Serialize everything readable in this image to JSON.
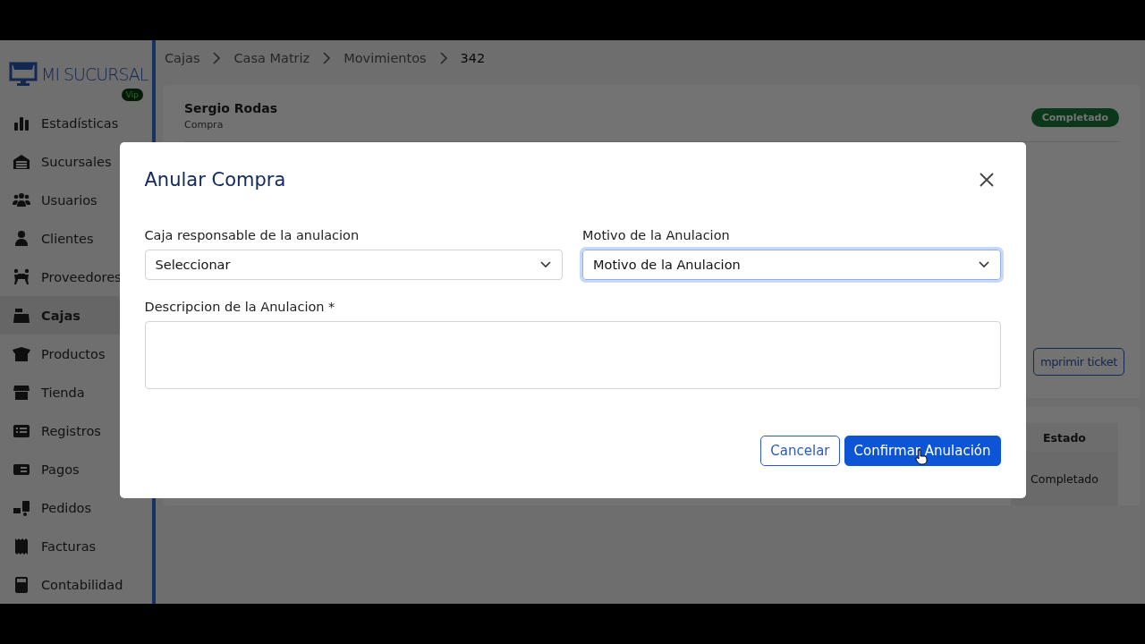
{
  "sidebar": {
    "logo": "MI SUCURSAL",
    "plan_badge": "Vip",
    "items": [
      {
        "label": "Estadísticas",
        "selected": false
      },
      {
        "label": "Sucursales",
        "selected": false
      },
      {
        "label": "Usuarios",
        "selected": false
      },
      {
        "label": "Clientes",
        "selected": false
      },
      {
        "label": "Proveedores",
        "selected": false
      },
      {
        "label": "Cajas",
        "selected": true
      },
      {
        "label": "Productos",
        "selected": false
      },
      {
        "label": "Tienda",
        "selected": false
      },
      {
        "label": "Registros",
        "selected": false
      },
      {
        "label": "Pagos",
        "selected": false
      },
      {
        "label": "Pedidos",
        "selected": false
      },
      {
        "label": "Facturas",
        "selected": false
      },
      {
        "label": "Contabilidad",
        "selected": false
      }
    ]
  },
  "breadcrumb": [
    "Cajas",
    "Casa Matriz",
    "Movimientos",
    "342"
  ],
  "movement": {
    "name": "Sergio Rodas",
    "type": "Compra",
    "status": "Completado",
    "print_button": "mprimir ticket"
  },
  "table": {
    "columns": [
      "Estado"
    ],
    "rows": [
      [
        "Completado"
      ]
    ]
  },
  "dialog": {
    "title": "Anular Compra",
    "fields": [
      {
        "kind": "select",
        "label": "Caja responsable de la anulacion",
        "value": "Seleccionar",
        "focused": false
      },
      {
        "kind": "select",
        "label": "Motivo de la Anulacion",
        "value": "Motivo de la Anulacion",
        "focused": true
      },
      {
        "kind": "textarea",
        "label": "Descripcion de la Anulacion",
        "required_mark": "*"
      }
    ],
    "buttons": [
      {
        "label": "Cancelar",
        "kind": "secondary"
      },
      {
        "label": "Confirmar Anulación",
        "kind": "primary"
      }
    ]
  }
}
